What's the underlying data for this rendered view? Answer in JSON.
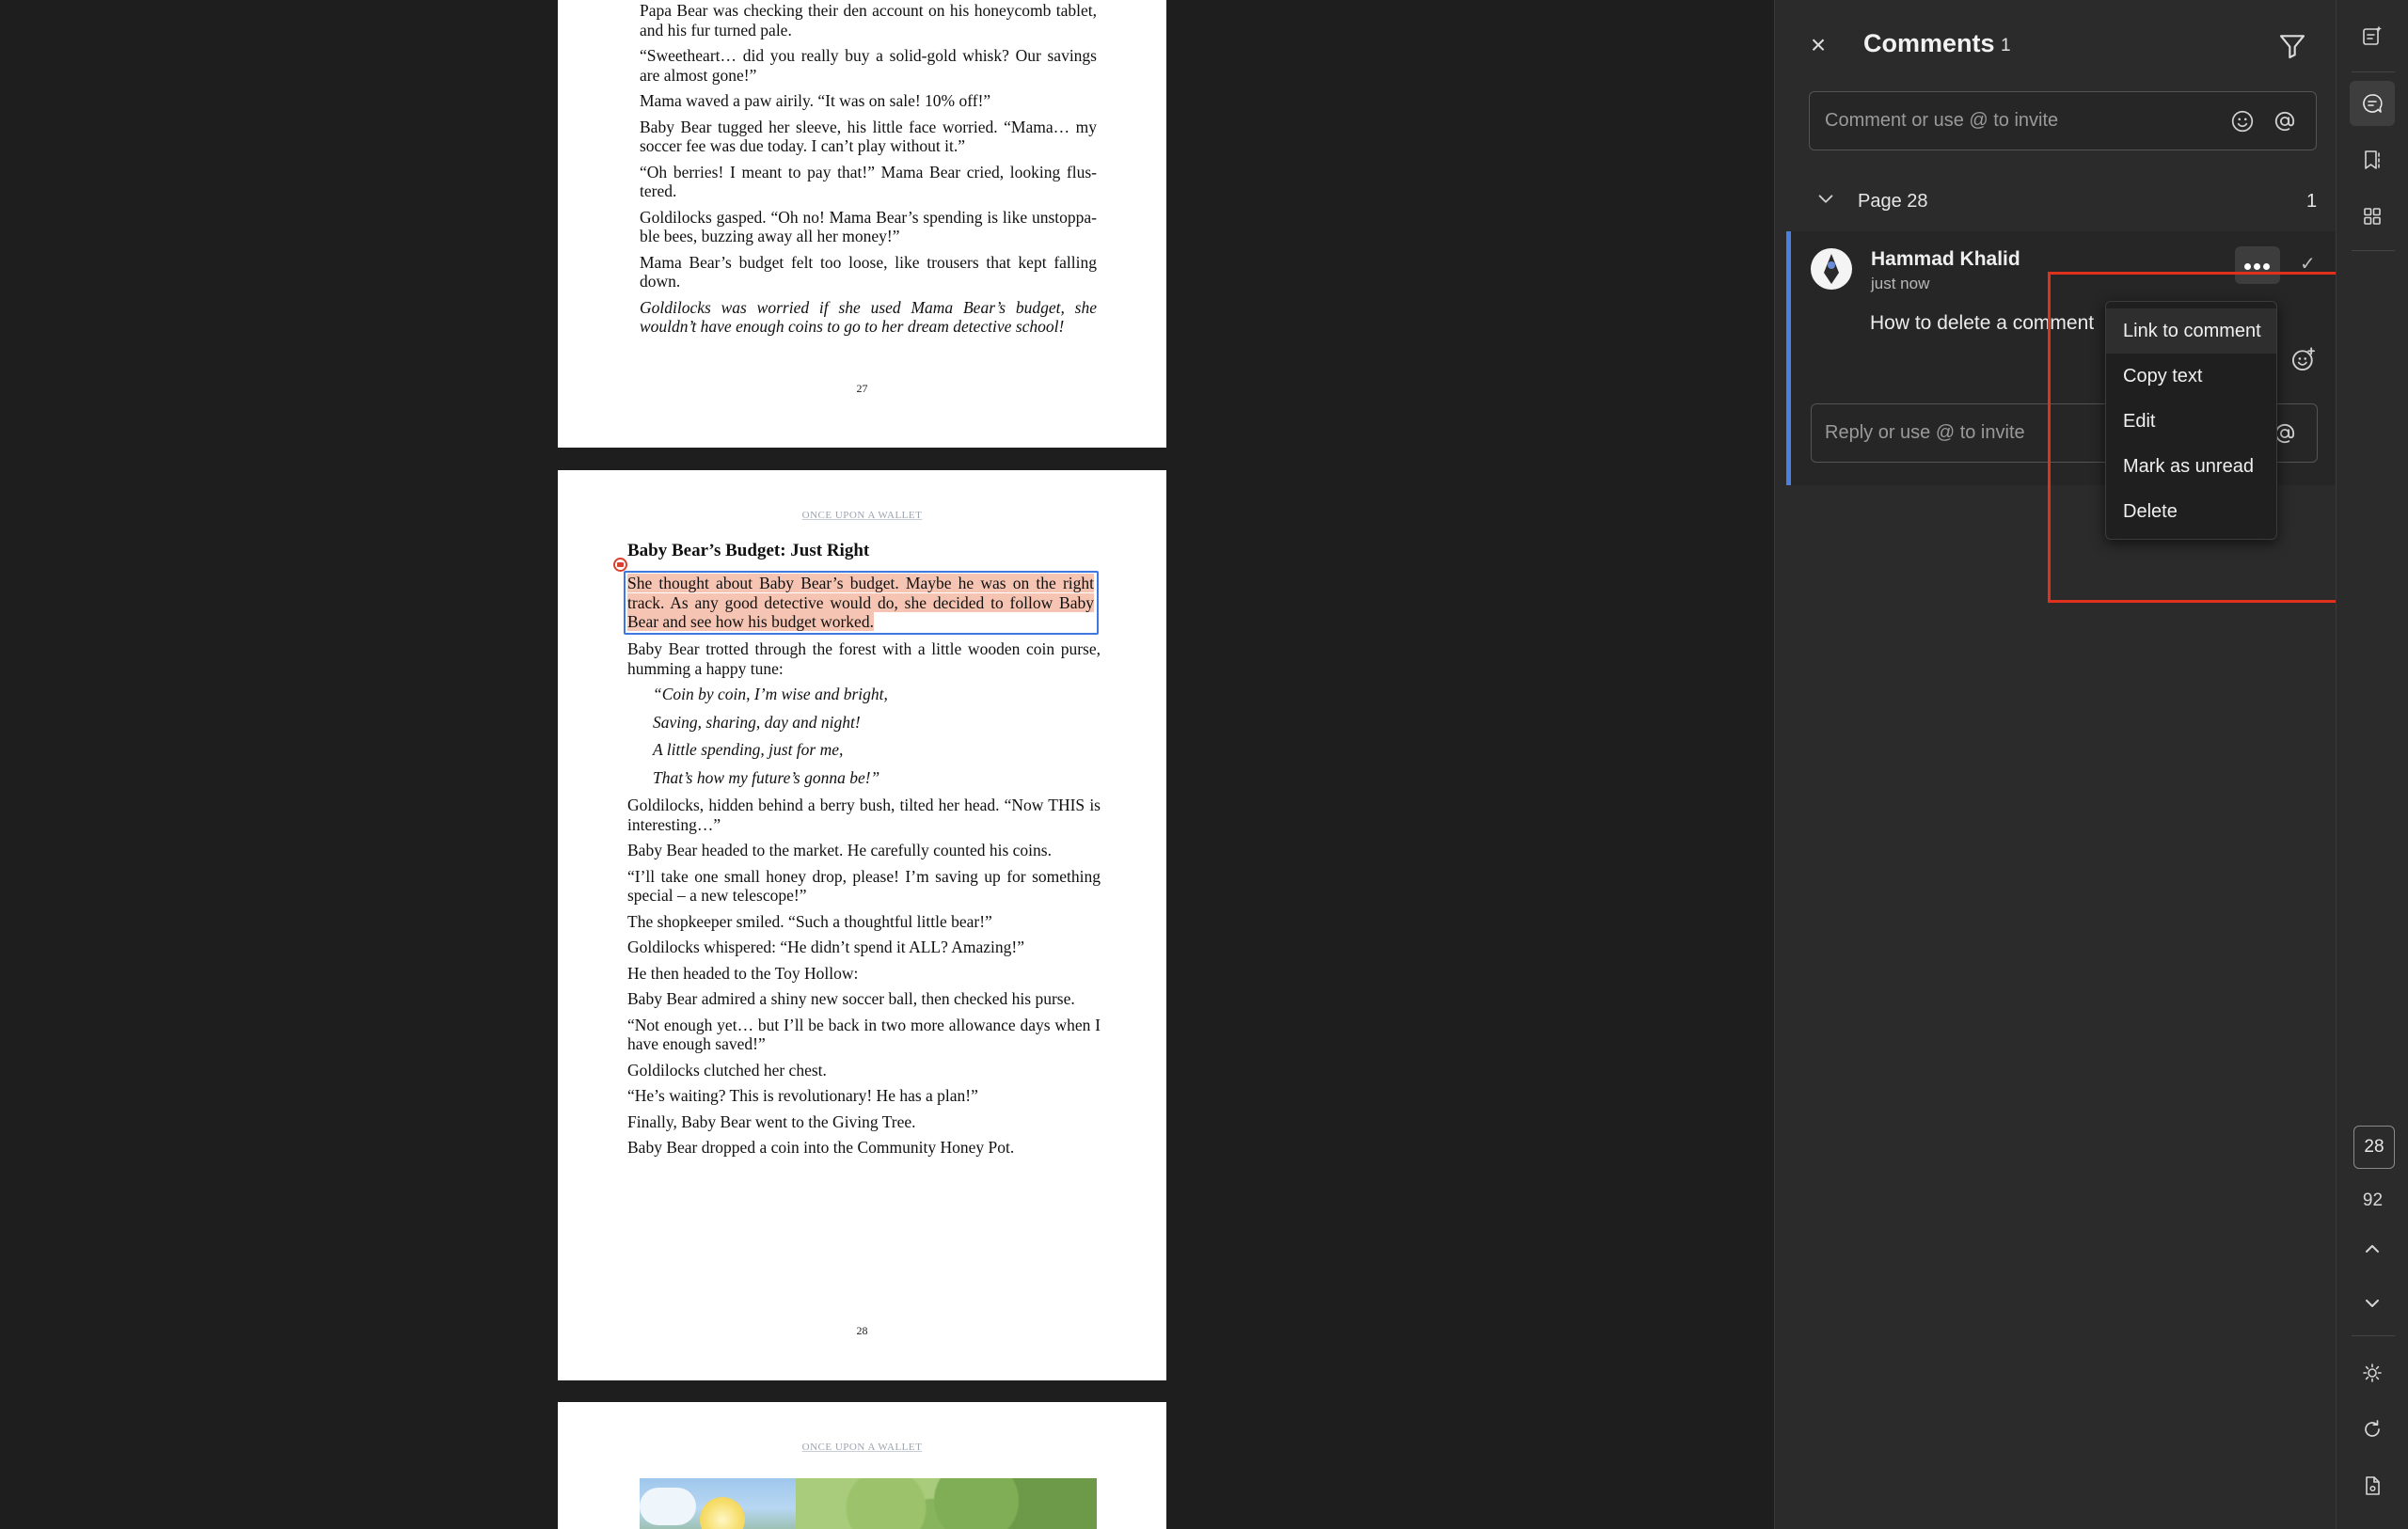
{
  "page27": {
    "paragraphs": [
      {
        "text": "Papa Bear was checking their den account on his honeycomb tablet, and his fur turned pale.",
        "italic": false
      },
      {
        "text": "“Sweetheart… did you really buy a solid-gold whisk? Our savings are almost gone!”",
        "italic": false
      },
      {
        "text": "Mama waved a paw airily. “It was on sale! 10% off!”",
        "italic": false
      },
      {
        "text": "Baby Bear tugged her sleeve, his little face worried. “Mama… my soccer fee was due today. I can’t play without it.”",
        "italic": false
      },
      {
        "text": "“Oh berries! I meant to pay that!” Mama Bear cried, looking flus- tered.",
        "italic": false
      },
      {
        "text": "Goldilocks gasped. “Oh no! Mama Bear’s spending is like unstoppa- ble bees, buzzing away all her money!”",
        "italic": false
      },
      {
        "text": "Mama Bear’s budget felt too loose, like trousers that kept falling down.",
        "italic": false
      },
      {
        "text": "Goldilocks was worried if she used Mama Bear’s budget, she wouldn’t have enough coins to go to her dream detective school!",
        "italic": true
      }
    ],
    "page_number": "27"
  },
  "page28": {
    "running_head": "ONCE UPON A WALLET",
    "chapter_title": "Baby Bear’s Budget: Just Right",
    "highlighted_text": "She thought about Baby Bear’s budget. Maybe he was on the right track. As any good detective would do, she decided to follow Baby Bear and see how his budget worked.",
    "intro": "Baby Bear trotted through the forest with a little wooden coin purse, humming a happy tune:",
    "poem": [
      "“Coin by coin, I’m wise and bright,",
      "Saving, sharing, day and night!",
      "A little spending, just for me,",
      "That’s how my future’s gonna be!”"
    ],
    "paragraphs": [
      "Goldilocks, hidden behind a berry bush, tilted her head. “Now THIS is interesting…”",
      "Baby Bear headed to the market. He carefully counted his coins.",
      "“I’ll take one small honey drop, please! I’m saving up for something special – a new telescope!”",
      "The shopkeeper smiled. “Such a thoughtful little bear!”",
      "Goldilocks whispered: “He didn’t spend it ALL? Amazing!”",
      "He then headed to the Toy Hollow:",
      "Baby Bear admired a shiny new soccer ball, then checked his purse.",
      "“Not enough yet… but I’ll be back in two more allowance days when I have enough saved!”",
      "Goldilocks clutched her chest.",
      "“He’s waiting? This is revolutionary! He has a plan!”",
      "Finally, Baby Bear went to the Giving Tree.",
      "Baby Bear dropped a coin into the Community Honey Pot."
    ],
    "page_number": "28"
  },
  "page29": {
    "running_head": "ONCE UPON A WALLET"
  },
  "comments_panel": {
    "title": "Comments",
    "count": "1",
    "input_placeholder": "Comment or use @ to invite",
    "group_label": "Page 28",
    "group_count": "1",
    "comment": {
      "author": "Hammad Khalid",
      "time": "just now",
      "text": "How to delete a comment",
      "reply_placeholder": "Reply or use @ to invite"
    },
    "menu": [
      "Link to comment",
      "Copy text",
      "Edit",
      "Mark as unread",
      "Delete"
    ],
    "accent_color": "#4b7fe0",
    "annotation_color": "#e0301e"
  },
  "right_rail": {
    "current_page": "28",
    "total_pages": "92",
    "icons": [
      "ai-assistant-icon",
      "comments-icon",
      "bookmark-icon",
      "thumbnails-icon",
      "page-up-icon",
      "page-down-icon",
      "brightness-icon",
      "refresh-icon",
      "document-settings-icon"
    ]
  }
}
